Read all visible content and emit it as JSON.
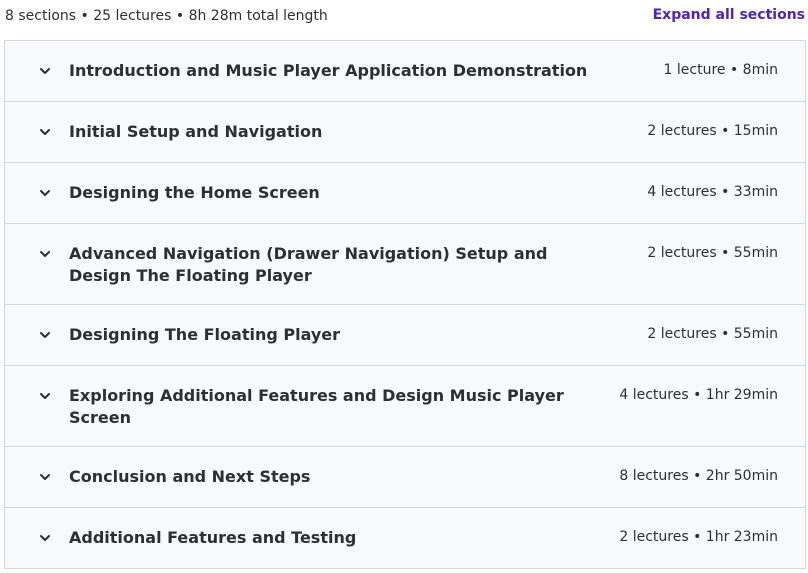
{
  "summary": {
    "text": "8 sections • 25 lectures • 8h 28m total length",
    "expand_label": "Expand all sections"
  },
  "icons": {
    "section_toggle": "chevron-down-icon"
  },
  "colors": {
    "accent": "#5022c3",
    "section_bg": "#f7f9fa",
    "border": "#d1d7dc",
    "text": "#2d2f31"
  },
  "sections": [
    {
      "title": "Introduction and Music Player Application Demonstration",
      "meta": "1 lecture • 8min"
    },
    {
      "title": "Initial Setup and Navigation",
      "meta": "2 lectures • 15min"
    },
    {
      "title": "Designing the Home Screen",
      "meta": "4 lectures • 33min"
    },
    {
      "title": "Advanced Navigation (Drawer Navigation) Setup and Design The Floating Player",
      "meta": "2 lectures • 55min"
    },
    {
      "title": "Designing The Floating Player",
      "meta": "2 lectures • 55min"
    },
    {
      "title": "Exploring Additional Features and Design Music Player Screen",
      "meta": "4 lectures • 1hr 29min"
    },
    {
      "title": "Conclusion and Next Steps",
      "meta": "8 lectures • 2hr 50min"
    },
    {
      "title": "Additional Features and Testing",
      "meta": "2 lectures • 1hr 23min"
    }
  ]
}
